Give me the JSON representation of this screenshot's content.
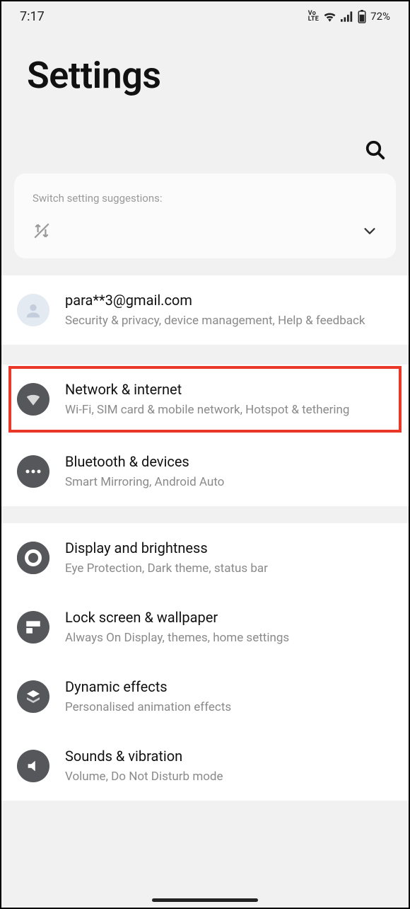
{
  "status": {
    "time": "7:17",
    "volte": "VoLTE",
    "battery": "72%"
  },
  "header": {
    "title": "Settings"
  },
  "suggestion": {
    "label": "Switch setting suggestions:"
  },
  "account": {
    "email": "para**3@gmail.com",
    "sub": "Security & privacy, device management, Help & feedback"
  },
  "items": [
    {
      "title": "Network & internet",
      "sub": "Wi-Fi, SIM card & mobile network, Hotspot & tethering"
    },
    {
      "title": "Bluetooth & devices",
      "sub": "Smart Mirroring, Android Auto"
    },
    {
      "title": "Display and brightness",
      "sub": "Eye Protection, Dark theme, status bar"
    },
    {
      "title": "Lock screen & wallpaper",
      "sub": "Always On Display, themes, home settings"
    },
    {
      "title": "Dynamic effects",
      "sub": "Personalised animation effects"
    },
    {
      "title": "Sounds & vibration",
      "sub": "Volume, Do Not Disturb mode"
    }
  ]
}
